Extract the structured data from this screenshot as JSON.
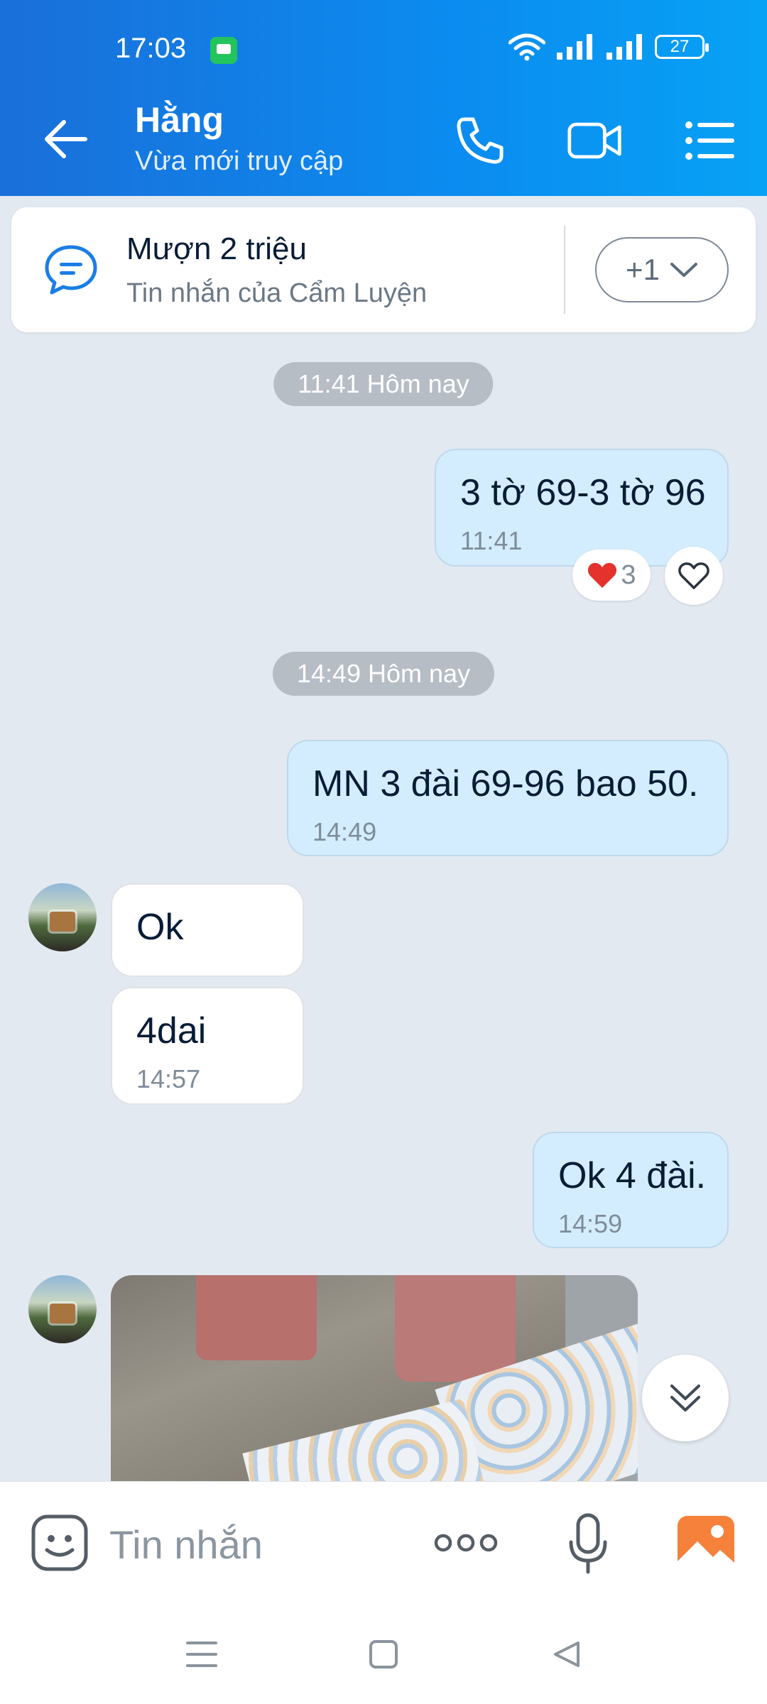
{
  "status_bar": {
    "time": "17:03",
    "battery": "27"
  },
  "header": {
    "name": "Hằng",
    "status": "Vừa mới truy cập"
  },
  "pinned": {
    "title": "Mượn 2 triệu",
    "subtitle": "Tin nhắn của Cẩm Luyện",
    "more_count": "+1"
  },
  "messages": [
    {
      "type": "time_pill",
      "text": "11:41 Hôm nay"
    },
    {
      "type": "out",
      "text": "3 tờ 69-3 tờ 96",
      "time": "11:41",
      "reaction": "3"
    },
    {
      "type": "time_pill",
      "text": "14:49 Hôm nay"
    },
    {
      "type": "out",
      "text": "MN 3 đài 69-96 bao 50.",
      "time": "14:49"
    },
    {
      "type": "in",
      "text": "Ok"
    },
    {
      "type": "in",
      "text": "4dai",
      "time": "14:57"
    },
    {
      "type": "out",
      "text": "Ok 4 đài.",
      "time": "14:59"
    },
    {
      "type": "in_image"
    }
  ],
  "composer": {
    "placeholder": "Tin nhắn"
  },
  "colors": {
    "header_start": "#1a6fd9",
    "header_end": "#07a2f5",
    "out_bubble": "#d3edfe",
    "in_bubble": "#ffffff",
    "chat_bg": "#e2e9f1"
  },
  "icons": [
    "back-arrow-icon",
    "phone-icon",
    "video-camera-icon",
    "menu-list-icon",
    "chat-bubble-icon",
    "chevron-down-icon",
    "heart-icon",
    "double-chevron-down-icon",
    "sticker-smiley-icon",
    "more-dots-icon",
    "microphone-icon",
    "image-gallery-icon"
  ]
}
